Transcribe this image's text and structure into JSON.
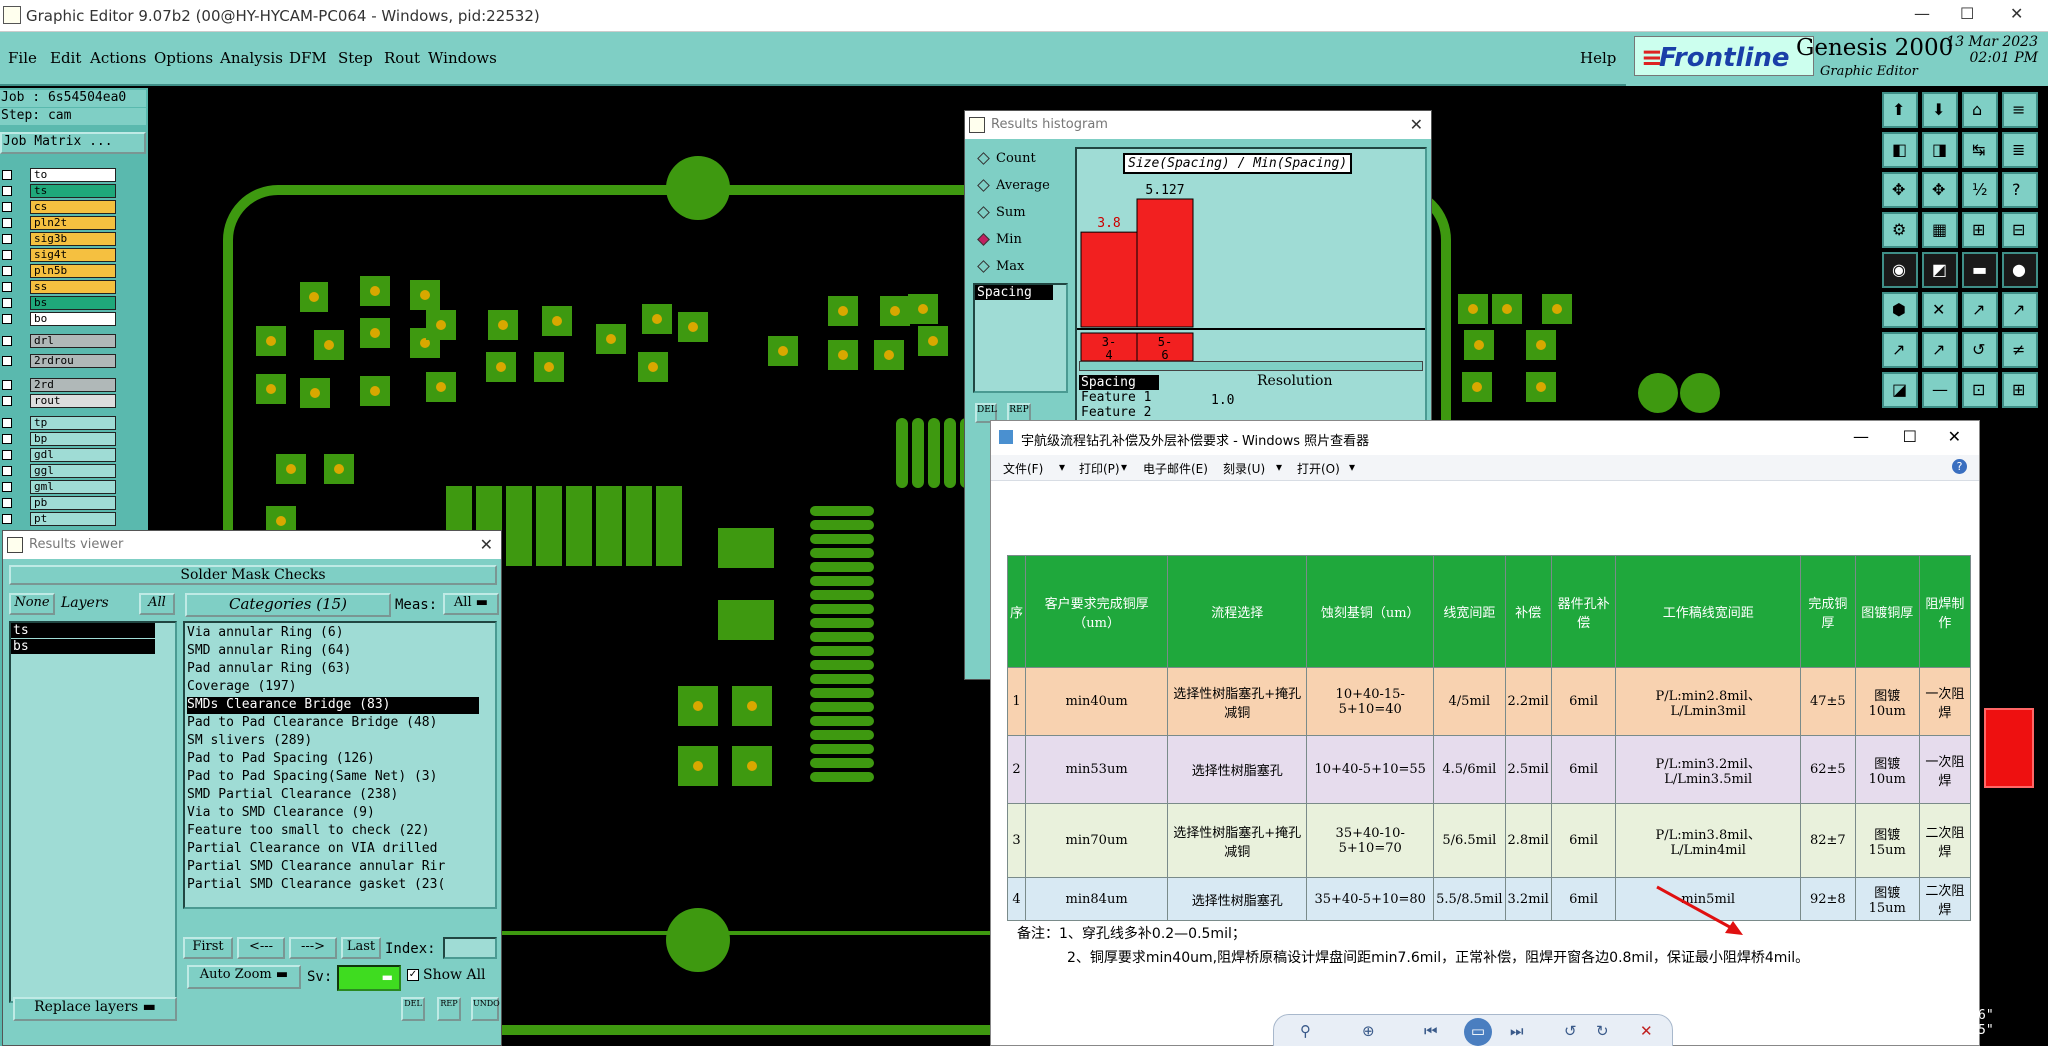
{
  "window": {
    "title": "Graphic Editor 9.07b2 (00@HY-HYCAM-PC064 - Windows, pid:22532)",
    "minimize": "—",
    "maximize": "☐",
    "close": "✕"
  },
  "menu": [
    "File",
    "Edit",
    "Actions",
    "Options",
    "Analysis",
    "DFM",
    "Step",
    "Rout",
    "Windows"
  ],
  "help": "Help",
  "brand": {
    "logo": "Frontline",
    "product": "Genesis 2000",
    "subtitle": "Graphic Editor",
    "date": "13 Mar 2023",
    "time": "02:01 PM"
  },
  "left": {
    "job": "Job : 6s54504ea0",
    "step": "Step: cam",
    "matrix_button": "Job Matrix ...",
    "layers": [
      {
        "name": "to",
        "color": "#ffffff"
      },
      {
        "name": "ts",
        "color": "#1fa87a"
      },
      {
        "name": "cs",
        "color": "#f5c040"
      },
      {
        "name": "pln2t",
        "color": "#f5c040"
      },
      {
        "name": "sig3b",
        "color": "#f5c040"
      },
      {
        "name": "sig4t",
        "color": "#f5c040"
      },
      {
        "name": "pln5b",
        "color": "#f5c040"
      },
      {
        "name": "ss",
        "color": "#f5c040"
      },
      {
        "name": "bs",
        "color": "#1fa87a"
      },
      {
        "name": "bo",
        "color": "#ffffff"
      }
    ],
    "drill_layers": [
      {
        "name": "drl",
        "color": "#b0b8b8"
      },
      {
        "name": "2rdrou",
        "color": "#b0b8b8"
      }
    ],
    "rout_layers": [
      {
        "name": "2rd",
        "color": "#b0b8b8"
      },
      {
        "name": "rout",
        "color": "#dddddd"
      }
    ],
    "doc_layers": [
      "tp",
      "bp",
      "gdl",
      "ggl",
      "gml",
      "pb",
      "pt"
    ]
  },
  "results_viewer": {
    "title": "Results viewer",
    "header": "Solder Mask Checks",
    "none": "None",
    "layers_label": "Layers",
    "all": "All",
    "layers": [
      "ts",
      "bs"
    ],
    "categories_label": "Categories (15)",
    "meas_label": "Meas:",
    "meas_value": "All",
    "categories": [
      "Via annular Ring (6)",
      "SMD annular Ring (64)",
      "Pad annular Ring (63)",
      "Coverage (197)",
      "SMDs Clearance Bridge (83)",
      "Pad to Pad Clearance Bridge (48)",
      "SM slivers (289)",
      "Pad to Pad Spacing (126)",
      "Pad to Pad Spacing(Same Net) (3)",
      "SMD Partial Clearance (238)",
      "Via to SMD Clearance (9)",
      "Feature too small to check (22)",
      "Partial Clearance on VIA drilled",
      "Partial SMD Clearance annular Rir",
      "Partial SMD Clearance gasket (23("
    ],
    "selected_index": 4,
    "nav": [
      "First",
      "<---",
      "--->",
      "Last"
    ],
    "index_label": "Index:",
    "auto_zoom": "Auto Zoom",
    "sv_label": "Sv:",
    "show_all": "Show All",
    "replace_layers": "Replace layers",
    "small_buttons": [
      "DEL",
      "REP",
      "UNDO"
    ]
  },
  "histogram": {
    "title": "Results histogram",
    "options": [
      "Count",
      "Average",
      "Sum",
      "Min",
      "Max"
    ],
    "selected_option": "Min",
    "chart_title": "Size(Spacing) / Min(Spacing)",
    "list_item": "Spacing",
    "list2": [
      "Spacing",
      "Feature 1",
      "Feature 2"
    ],
    "resolution_label": "Resolution",
    "resolution_value": "1.0",
    "small_buttons": [
      "DEL",
      "REP"
    ],
    "chart_data": {
      "type": "bar",
      "categories": [
        "3-4",
        "5-6"
      ],
      "category_labels_top": [
        "3-",
        "5-"
      ],
      "category_labels_bottom": [
        "4",
        "6"
      ],
      "values": [
        3.8,
        5.127
      ],
      "value_labels": [
        "3.8",
        "5.127"
      ],
      "ylim": [
        0,
        5.127
      ]
    }
  },
  "photo_viewer": {
    "title": "宇航级流程钻孔补偿及外层补偿要求 - Windows 照片查看器",
    "menu": [
      "文件(F)",
      "打印(P)",
      "电子邮件(E)",
      "刻录(U)",
      "打开(O)"
    ],
    "table": {
      "headers": [
        "序",
        "客户要求完成铜厚（um）",
        "流程选择",
        "蚀刻基铜（um）",
        "线宽间距",
        "补偿",
        "器件孔补偿",
        "工作稿线宽间距",
        "完成铜厚",
        "图镀铜厚",
        "阻焊制作"
      ],
      "rows": [
        [
          "1",
          "min40um",
          "选择性树脂塞孔+掩孔减铜",
          "10+40-15-5+10=40",
          "4/5mil",
          "2.2mil",
          "6mil",
          "P/L:min2.8mil、L/Lmin3mil",
          "47±5",
          "图镀10um",
          "一次阻焊"
        ],
        [
          "2",
          "min53um",
          "选择性树脂塞孔",
          "10+40-5+10=55",
          "4.5/6mil",
          "2.5mil",
          "6mil",
          "P/L:min3.2mil、L/Lmin3.5mil",
          "62±5",
          "图镀10um",
          "一次阻焊"
        ],
        [
          "3",
          "min70um",
          "选择性树脂塞孔+掩孔减铜",
          "35+40-10-5+10=70",
          "5/6.5mil",
          "2.8mil",
          "6mil",
          "P/L:min3.8mil、L/Lmin4mil",
          "82±7",
          "图镀15um",
          "二次阻焊"
        ],
        [
          "4",
          "min84um",
          "选择性树脂塞孔",
          "35+40-5+10=80",
          "5.5/8.5mil",
          "3.2mil",
          "6mil",
          "min5mil",
          "92±8",
          "图镀15um",
          "二次阻焊"
        ]
      ]
    },
    "note1": "备注：1、穿孔线多补0.2—0.5mil；",
    "note2": "2、铜厚要求min40um,阻焊桥原稿设计焊盘间距min7.6mil，正常补偿，阻焊开窗各边0.8mil，保证最小阻焊桥4mil。"
  },
  "status_right": [
    "6\"",
    "5\""
  ]
}
